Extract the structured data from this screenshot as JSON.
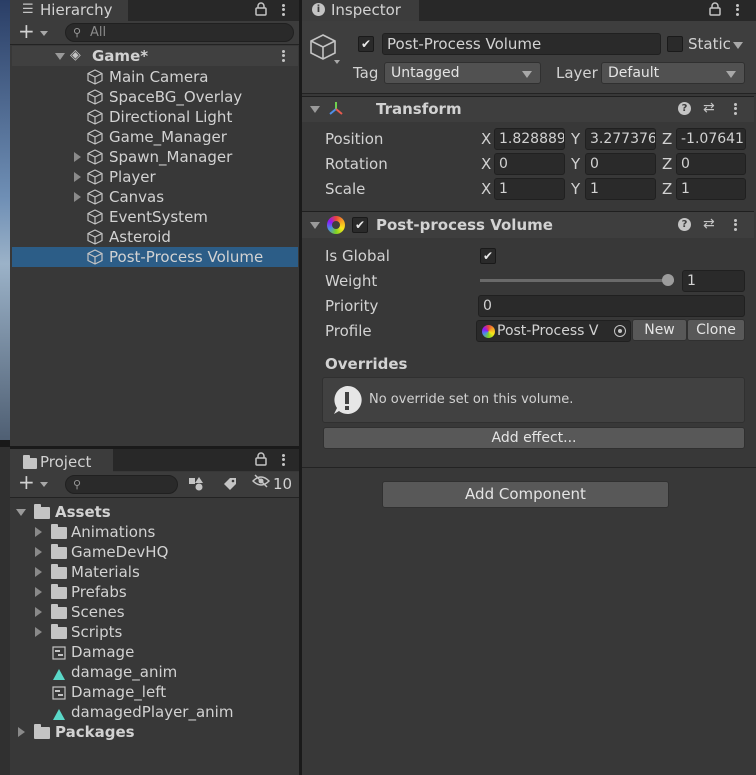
{
  "hierarchy": {
    "tab_label": "Hierarchy",
    "search_placeholder": "All",
    "scene_name": "Game*",
    "items": [
      {
        "label": "Main Camera",
        "expandable": false
      },
      {
        "label": "SpaceBG_Overlay",
        "expandable": false
      },
      {
        "label": "Directional Light",
        "expandable": false
      },
      {
        "label": "Game_Manager",
        "expandable": false
      },
      {
        "label": "Spawn_Manager",
        "expandable": true
      },
      {
        "label": "Player",
        "expandable": true
      },
      {
        "label": "Canvas",
        "expandable": true
      },
      {
        "label": "EventSystem",
        "expandable": false
      },
      {
        "label": "Asteroid",
        "expandable": false
      },
      {
        "label": "Post-Process Volume",
        "expandable": false,
        "selected": true
      }
    ]
  },
  "project": {
    "tab_label": "Project",
    "hidden_count": "10",
    "root_label": "Assets",
    "folders": [
      "Animations",
      "GameDevHQ",
      "Materials",
      "Prefabs",
      "Scenes",
      "Scripts"
    ],
    "files": [
      {
        "label": "Damage",
        "icon": "animator-controller-icon"
      },
      {
        "label": "damage_anim",
        "icon": "animation-clip-icon"
      },
      {
        "label": "Damage_left",
        "icon": "animator-controller-icon"
      },
      {
        "label": "damagedPlayer_anim",
        "icon": "animation-clip-icon"
      }
    ],
    "packages_label": "Packages"
  },
  "inspector": {
    "tab_label": "Inspector",
    "object_name": "Post-Process Volume",
    "static_label": "Static",
    "tag_label": "Tag",
    "tag_value": "Untagged",
    "layer_label": "Layer",
    "layer_value": "Default",
    "transform": {
      "title": "Transform",
      "position_label": "Position",
      "rotation_label": "Rotation",
      "scale_label": "Scale",
      "position": {
        "x": "1.828889",
        "y": "3.277376",
        "z": "-1.07641"
      },
      "rotation": {
        "x": "0",
        "y": "0",
        "z": "0"
      },
      "scale": {
        "x": "1",
        "y": "1",
        "z": "1"
      },
      "axis_x": "X",
      "axis_y": "Y",
      "axis_z": "Z"
    },
    "post_process": {
      "title": "Post-process Volume",
      "is_global_label": "Is Global",
      "weight_label": "Weight",
      "weight_value": "1",
      "weight_slider": 1.0,
      "priority_label": "Priority",
      "priority_value": "0",
      "profile_label": "Profile",
      "profile_value": "Post-Process V",
      "new_label": "New",
      "clone_label": "Clone",
      "overrides_label": "Overrides",
      "no_override_text": "No override set on this volume.",
      "add_effect_label": "Add effect..."
    },
    "add_component_label": "Add Component"
  },
  "colors": {
    "selection": "#2c5d87",
    "panel_bg": "#383838",
    "header_bg": "#3e3e3e"
  }
}
